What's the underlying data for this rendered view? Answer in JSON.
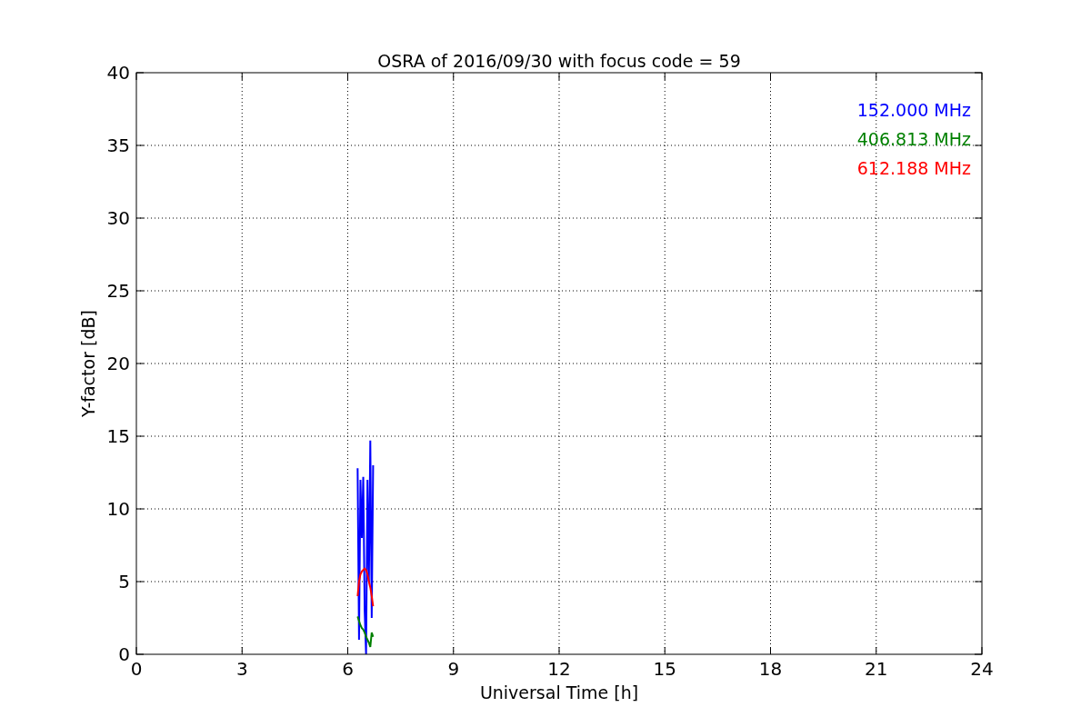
{
  "chart_data": {
    "type": "line",
    "title": "OSRA of 2016/09/30 with focus code = 59",
    "xlabel": "Universal Time [h]",
    "ylabel": "Y-factor [dB]",
    "x": [
      6.28,
      6.32,
      6.36,
      6.4,
      6.44,
      6.48,
      6.52,
      6.56,
      6.6,
      6.64,
      6.68,
      6.72
    ],
    "series": [
      {
        "name": "152.000 MHz",
        "color": "#0000ff",
        "values": [
          12.8,
          1,
          12,
          8,
          12.2,
          3,
          0,
          12,
          5,
          14.7,
          2.5,
          13
        ]
      },
      {
        "name": "406.813 MHz",
        "color": "#008000",
        "values": [
          2.6,
          2.3,
          2,
          1.8,
          1.7,
          1.5,
          1.2,
          1,
          0.8,
          0.5,
          1.5,
          1.2
        ]
      },
      {
        "name": "612.188 MHz",
        "color": "#ff0000",
        "values": [
          4,
          5,
          5.5,
          5.7,
          5.8,
          5.9,
          5.8,
          5.5,
          5,
          4.6,
          4,
          3.3
        ]
      }
    ],
    "xlim": [
      0,
      24
    ],
    "ylim": [
      0,
      40
    ],
    "grid": true,
    "xticks": [
      0,
      3,
      6,
      9,
      12,
      15,
      18,
      21,
      24
    ],
    "yticks": [
      0,
      5,
      10,
      15,
      20,
      25,
      30,
      35,
      40
    ]
  }
}
